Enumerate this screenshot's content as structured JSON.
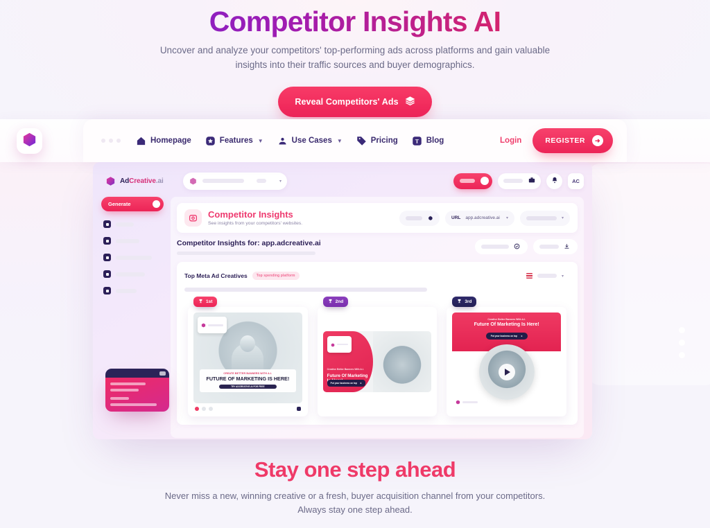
{
  "hero": {
    "title": "Competitor Insights AI",
    "subtitle": "Uncover and analyze your competitors' top-performing ads across platforms and gain valuable insights into their traffic sources and buyer demographics.",
    "cta_label": "Reveal Competitors' Ads",
    "cta_icon": "layers-icon",
    "accent_pink": "#ef2357",
    "title_gradient_from": "#6d28d9",
    "title_gradient_to": "#ef2d56"
  },
  "nav": {
    "brand_icon": "adcreative-cube-icon",
    "items": [
      {
        "label": "Homepage",
        "icon": "home-icon",
        "has_chevron": false
      },
      {
        "label": "Features",
        "icon": "star-badge-icon",
        "has_chevron": true
      },
      {
        "label": "Use Cases",
        "icon": "users-icon",
        "has_chevron": true
      },
      {
        "label": "Pricing",
        "icon": "price-tag-icon",
        "has_chevron": false
      },
      {
        "label": "Blog",
        "icon": "text-box-icon",
        "has_chevron": false
      }
    ],
    "login_label": "Login",
    "register_label": "REGISTER",
    "register_icon": "arrow-right-icon"
  },
  "app": {
    "logo": {
      "ad": "Ad",
      "creative": "Creative",
      "dotai": ".ai",
      "icon": "adcreative-cube-icon"
    },
    "avatar_initials": "AC",
    "bell_icon": "bell-icon",
    "topbar_icon": "briefcase-icon",
    "sidebar": {
      "generate_label": "Generate",
      "items": [
        {
          "icon": "dashboard-icon"
        },
        {
          "icon": "image-icon"
        },
        {
          "icon": "chart-icon"
        },
        {
          "icon": "target-icon"
        },
        {
          "icon": "settings-icon"
        }
      ]
    },
    "panel": {
      "icon": "camera-badge-icon",
      "title": "Competitor Insights",
      "subtitle": "See insights from your competitors' websites.",
      "settings_icon": "gear-icon",
      "url_label": "URL",
      "url_value": "app.adcreative.ai"
    },
    "insights_for": {
      "title": "Competitor Insights for: app.adcreative.ai",
      "check_icon": "check-circle-icon",
      "download_icon": "download-icon"
    },
    "meta": {
      "title": "Top Meta Ad Creatives",
      "badge": "Top spending platform",
      "flag_icon": "us-flag-icon"
    },
    "ads": [
      {
        "rank": "1st",
        "rank_icon": "trophy-icon",
        "format": "square",
        "kicker": "CREATE BETTER BANNERS WITH A.I.",
        "headline": "FUTURE OF MARKETING IS HERE!",
        "cta": "TRY ADCREATIVE.AI FOR FREE"
      },
      {
        "rank": "2nd",
        "rank_icon": "trophy-icon",
        "format": "landscape",
        "kicker": "Creative Better Banners With A.I.",
        "headline": "Future Of Marketing Is Here!",
        "cta": "Put your business on top"
      },
      {
        "rank": "3rd",
        "rank_icon": "trophy-icon",
        "format": "video",
        "kicker": "Creative Better Banners With A.I.",
        "headline": "Future Of Marketing Is Here!",
        "cta": "Put your business on top",
        "play_icon": "play-icon"
      }
    ]
  },
  "footer": {
    "title": "Stay one step ahead",
    "subtitle": "Never miss a new, winning creative or a fresh, buyer acquisition channel from your competitors. Always stay one step ahead."
  }
}
